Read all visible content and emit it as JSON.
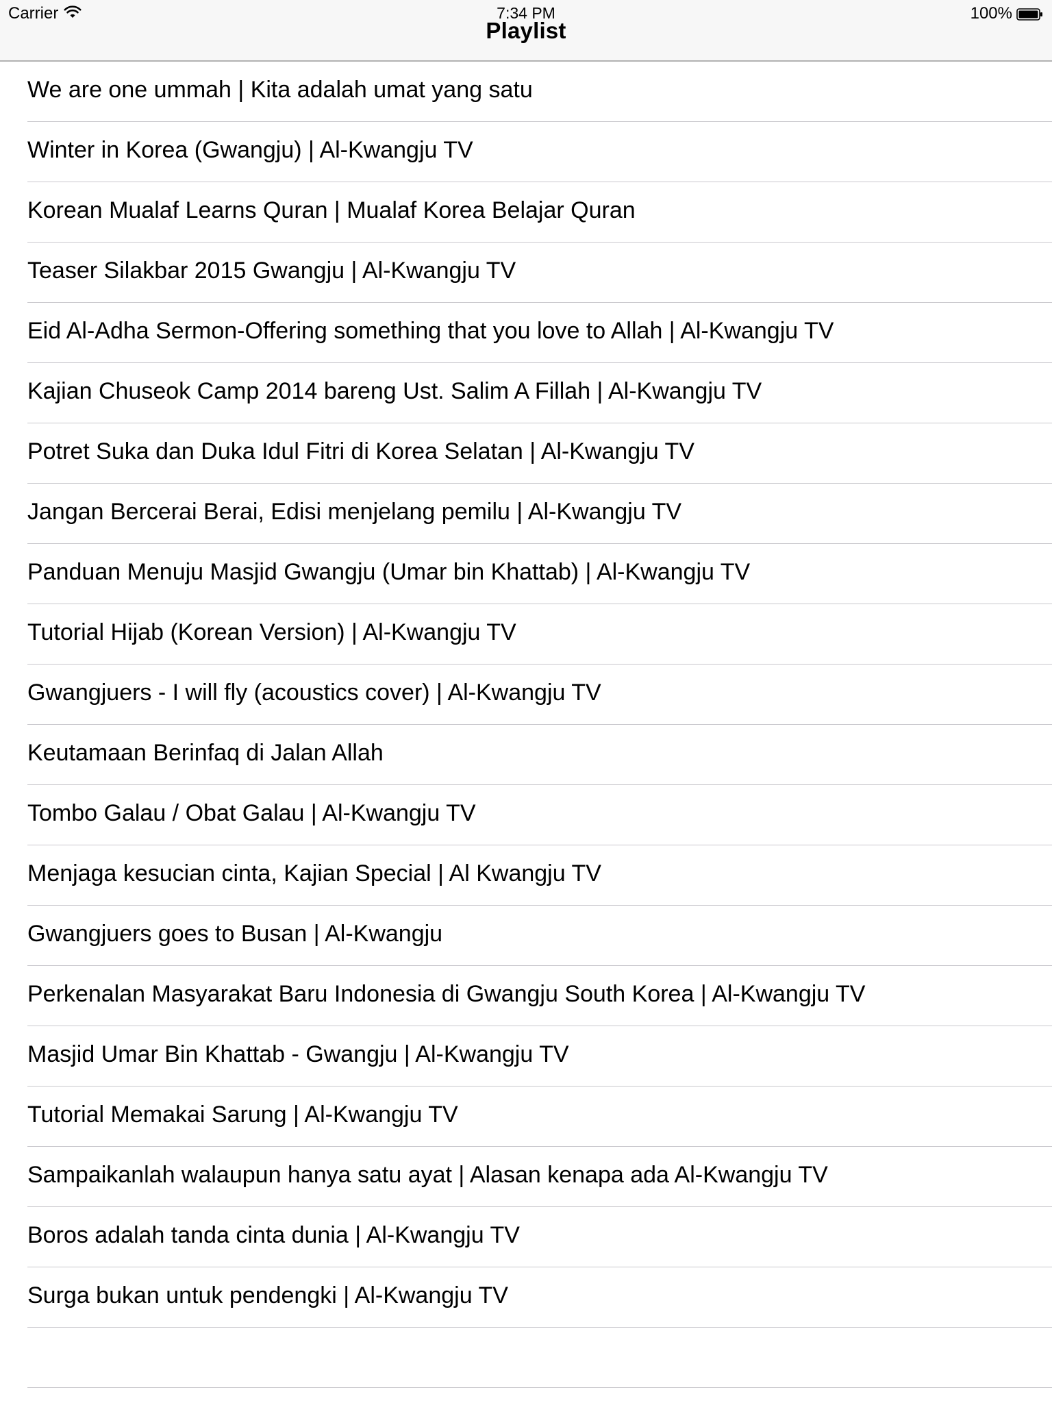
{
  "status_bar": {
    "carrier": "Carrier",
    "time": "7:34 PM",
    "battery": "100%",
    "wifi_icon": "wifi-icon",
    "battery_icon": "battery-icon"
  },
  "nav": {
    "title": "Playlist"
  },
  "playlist": {
    "items": [
      {
        "label": "We are one ummah | Kita adalah umat yang satu"
      },
      {
        "label": "Winter in Korea (Gwangju) | Al-Kwangju TV"
      },
      {
        "label": "Korean Mualaf Learns Quran | Mualaf Korea Belajar Quran"
      },
      {
        "label": "Teaser Silakbar 2015 Gwangju | Al-Kwangju TV"
      },
      {
        "label": "Eid Al-Adha Sermon-Offering something that you love to Allah | Al-Kwangju TV"
      },
      {
        "label": "Kajian Chuseok Camp 2014 bareng Ust. Salim A Fillah | Al-Kwangju TV"
      },
      {
        "label": "Potret Suka dan Duka Idul Fitri di Korea Selatan | Al-Kwangju TV"
      },
      {
        "label": "Jangan Bercerai Berai, Edisi menjelang pemilu | Al-Kwangju TV"
      },
      {
        "label": "Panduan Menuju Masjid Gwangju (Umar bin Khattab) | Al-Kwangju TV"
      },
      {
        "label": "Tutorial Hijab (Korean Version) | Al-Kwangju TV"
      },
      {
        "label": "Gwangjuers - I will fly (acoustics cover) | Al-Kwangju TV"
      },
      {
        "label": "Keutamaan Berinfaq di Jalan Allah"
      },
      {
        "label": "Tombo Galau / Obat Galau | Al-Kwangju TV"
      },
      {
        "label": "Menjaga kesucian cinta, Kajian Special | Al Kwangju TV"
      },
      {
        "label": "Gwangjuers goes to Busan | Al-Kwangju"
      },
      {
        "label": "Perkenalan Masyarakat Baru Indonesia di Gwangju South Korea | Al-Kwangju TV"
      },
      {
        "label": "Masjid Umar Bin Khattab - Gwangju | Al-Kwangju TV"
      },
      {
        "label": "Tutorial Memakai Sarung | Al-Kwangju TV"
      },
      {
        "label": "Sampaikanlah walaupun hanya satu ayat | Alasan kenapa ada Al-Kwangju TV"
      },
      {
        "label": "Boros adalah tanda cinta dunia | Al-Kwangju TV"
      },
      {
        "label": "Surga bukan untuk pendengki | Al-Kwangju TV"
      }
    ]
  },
  "colors": {
    "bar_background": "#f7f7f7",
    "separator": "#c8c7cc",
    "text": "#000000"
  }
}
